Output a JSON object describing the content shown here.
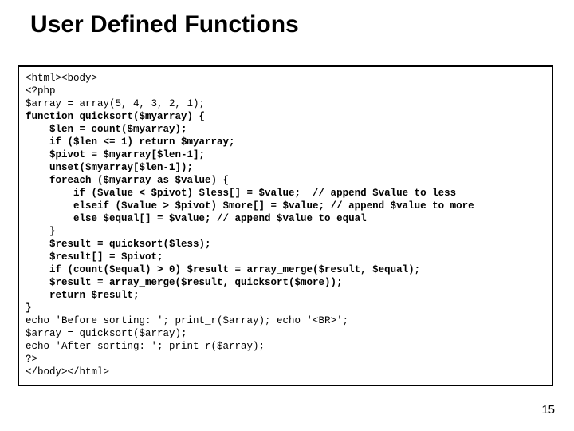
{
  "title": "User Defined Functions",
  "page_number": "15",
  "code": {
    "l01": "<html><body>",
    "l02": "<?php",
    "l03": "$array = array(5, 4, 3, 2, 1);",
    "l04": "function quicksort($myarray) {",
    "l05": "    $len = count($myarray);",
    "l06": "    if ($len <= 1) return $myarray;",
    "l07": "    $pivot = $myarray[$len-1];",
    "l08": "    unset($myarray[$len-1]);",
    "l09": "    foreach ($myarray as $value) {",
    "l10": "        if ($value < $pivot) $less[] = $value;  // append $value to less",
    "l11": "        elseif ($value > $pivot) $more[] = $value; // append $value to more",
    "l12": "        else $equal[] = $value; // append $value to equal",
    "l13": "    }",
    "l14": "    $result = quicksort($less);",
    "l15": "    $result[] = $pivot;",
    "l16": "    if (count($equal) > 0) $result = array_merge($result, $equal);",
    "l17": "    $result = array_merge($result, quicksort($more));",
    "l18": "    return $result;",
    "l19": "}",
    "l20": "echo 'Before sorting: '; print_r($array); echo '<BR>';",
    "l21": "$array = quicksort($array);",
    "l22": "echo 'After sorting: '; print_r($array);",
    "l23": "?>",
    "l24": "</body></html>"
  }
}
